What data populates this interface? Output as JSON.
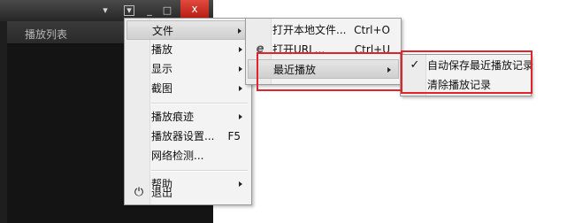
{
  "player": {
    "playlist_title": "播放列表",
    "close_glyph": "x",
    "chat_glyph": "▾",
    "menu_glyph": "▾",
    "min_glyph": "_",
    "max_glyph": "□"
  },
  "main_menu": {
    "items": [
      {
        "label": "文件",
        "shortcut": ""
      },
      {
        "label": "播放",
        "shortcut": ""
      },
      {
        "label": "显示",
        "shortcut": ""
      },
      {
        "label": "截图",
        "shortcut": ""
      },
      {
        "label": "播放痕迹",
        "shortcut": ""
      },
      {
        "label": "播放器设置...",
        "shortcut": "F5"
      },
      {
        "label": "网络检测...",
        "shortcut": ""
      },
      {
        "label": "帮助",
        "shortcut": ""
      },
      {
        "label": "退出",
        "shortcut": ""
      }
    ]
  },
  "file_menu": {
    "items": [
      {
        "label": "打开本地文件...",
        "shortcut": "Ctrl+O"
      },
      {
        "label": "打开URL...",
        "shortcut": "Ctrl+U"
      },
      {
        "label": "最近播放",
        "shortcut": ""
      }
    ]
  },
  "recent_menu": {
    "items": [
      {
        "label": "自动保存最近播放记录",
        "checked": true
      },
      {
        "label": "清除播放记录",
        "checked": false
      }
    ]
  },
  "colors": {
    "highlight_box": "#e0242b",
    "close_button": "#c8281c"
  }
}
